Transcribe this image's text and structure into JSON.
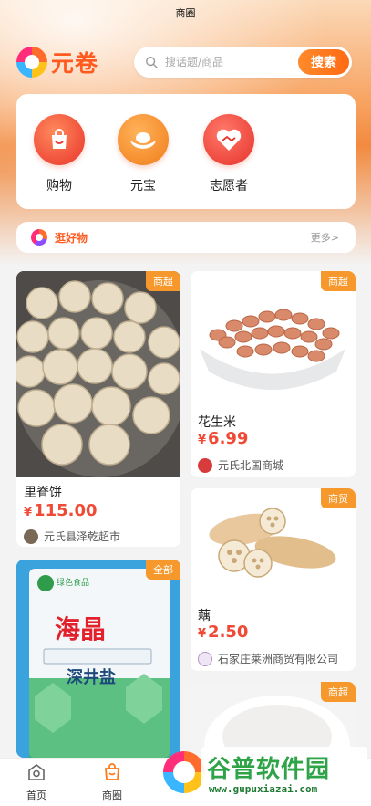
{
  "status_bar": {
    "title": "商圈"
  },
  "header": {
    "logo_text": "元卷",
    "search": {
      "placeholder": "搜话题/商品",
      "button_label": "搜索"
    }
  },
  "quick_menu": [
    {
      "label": "购物",
      "icon": "shopping-bag-icon"
    },
    {
      "label": "元宝",
      "icon": "ingot-icon"
    },
    {
      "label": "志愿者",
      "icon": "handshake-icon"
    }
  ],
  "good_things": {
    "title": "逛好物",
    "more": "更多>"
  },
  "products": [
    {
      "badge": "商超",
      "name": "里脊饼",
      "currency": "¥",
      "price": "115.00",
      "shop": "元氏县泽乾超市"
    },
    {
      "badge": "商超",
      "name": "花生米",
      "currency": "¥",
      "price": "6.99",
      "shop": "元氏北国商城"
    },
    {
      "badge": "商贸",
      "name": "藕",
      "currency": "¥",
      "price": "2.50",
      "shop": "石家庄莱洲商贸有限公司"
    },
    {
      "badge": "全部",
      "name": "",
      "currency": "",
      "price": "",
      "shop": "",
      "package_text": "海晶",
      "package_sub": "深井盐",
      "package_brand": "绿色食品"
    },
    {
      "badge": "商超",
      "name": "",
      "currency": "",
      "price": "",
      "shop": ""
    }
  ],
  "tabbar": {
    "items": [
      {
        "label": "首页",
        "icon": "home-icon"
      },
      {
        "label": "商圈",
        "icon": "shop-bag-icon",
        "active": true
      }
    ]
  },
  "watermark": {
    "title": "谷普软件园",
    "url": "www.gupuxiazai.com"
  },
  "colors": {
    "accent": "#ff6a13",
    "price": "#f04935",
    "badge": "#f6982c"
  }
}
